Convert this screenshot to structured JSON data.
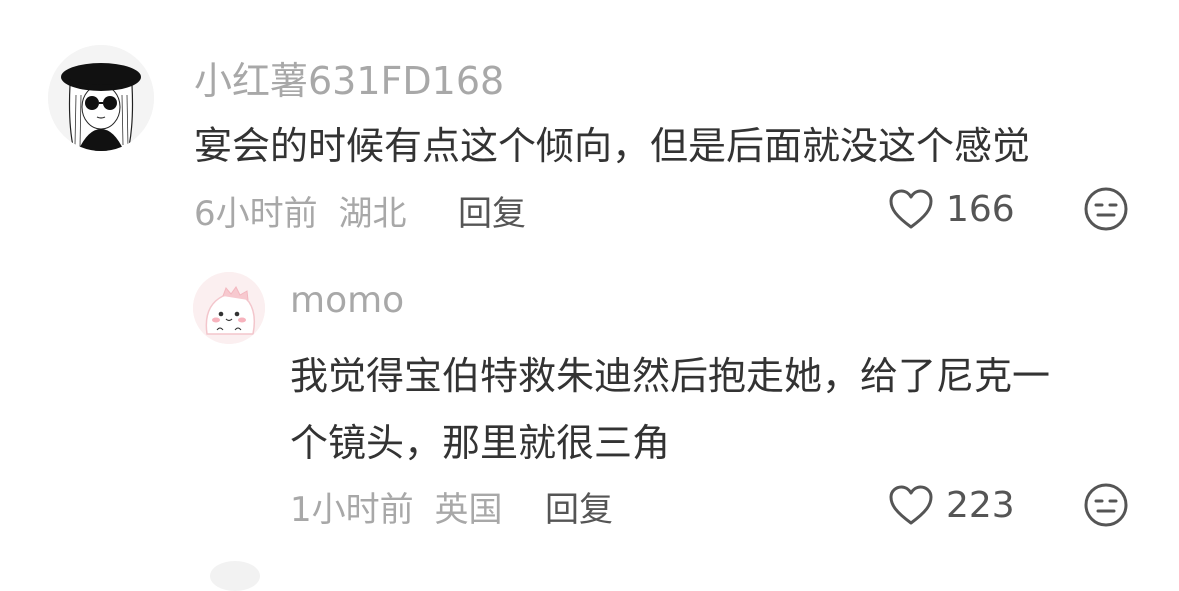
{
  "comments": [
    {
      "username": "小红薯631FD168",
      "text": "宴会的时候有点这个倾向，但是后面就没这个感觉",
      "time": "6小时前",
      "location": "湖北",
      "reply_label": "回复",
      "likes": "166",
      "avatar_icon": "girl-in-hat-sunglasses-avatar"
    },
    {
      "username": "momo",
      "text_line1": "我觉得宝伯特救朱迪然后抱走她，给了尼克一",
      "text_line2": "个镜头，那里就很三角",
      "time": "1小时前",
      "location": "英国",
      "reply_label": "回复",
      "likes": "223",
      "avatar_icon": "pink-cartoon-avatar"
    }
  ],
  "icons": {
    "like": "heart-outline-icon",
    "dislike": "meh-face-icon"
  },
  "colors": {
    "text": "#333333",
    "meta": "#a8a8a8",
    "action": "#555555"
  }
}
